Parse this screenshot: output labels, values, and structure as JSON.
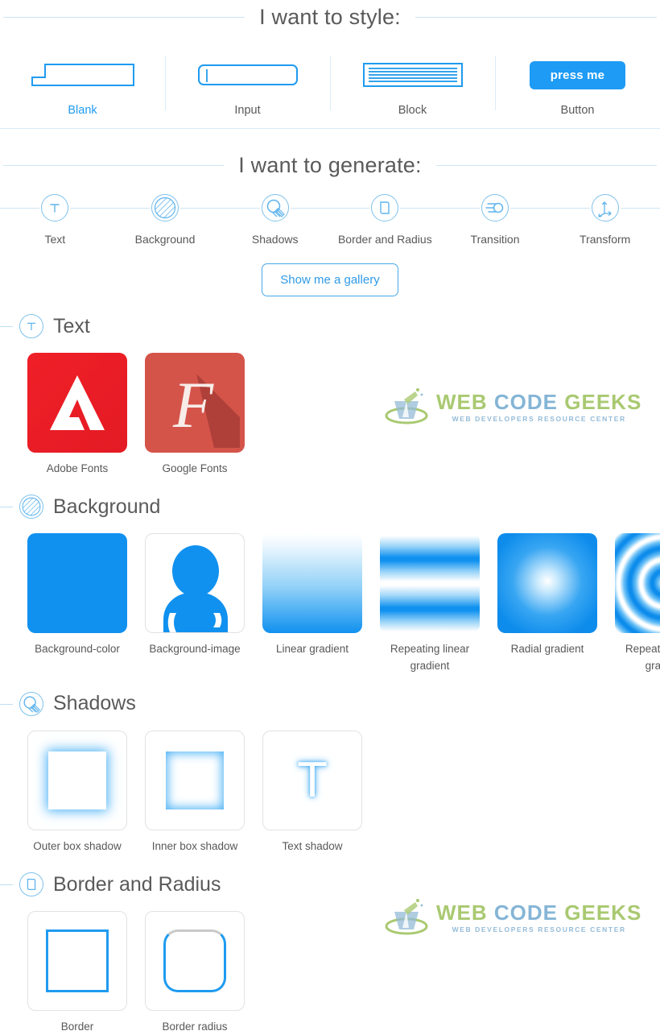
{
  "style_section": {
    "title": "I want to style:",
    "items": [
      {
        "label": "Blank",
        "icon": "blank-document-icon",
        "active": true
      },
      {
        "label": "Input",
        "icon": "text-input-icon",
        "active": false
      },
      {
        "label": "Block",
        "icon": "text-block-icon",
        "active": false
      },
      {
        "label": "Button",
        "icon": "button-icon",
        "button_label": "press me",
        "active": false
      }
    ]
  },
  "generate_section": {
    "title": "I want to generate:",
    "items": [
      {
        "label": "Text",
        "icon": "letter-t-icon"
      },
      {
        "label": "Background",
        "icon": "hatched-circle-icon"
      },
      {
        "label": "Shadows",
        "icon": "shadow-drop-icon"
      },
      {
        "label": "Border and Radius",
        "icon": "rounded-square-icon"
      },
      {
        "label": "Transition",
        "icon": "motion-lines-icon"
      },
      {
        "label": "Transform",
        "icon": "axes-arrows-icon"
      }
    ],
    "gallery_button": "Show me a gallery"
  },
  "groups": [
    {
      "title": "Text",
      "icon": "letter-t-icon",
      "cards": [
        {
          "label": "Adobe Fonts",
          "icon": "adobe-logo-icon",
          "glyph": "A"
        },
        {
          "label": "Google Fonts",
          "icon": "google-fonts-logo-icon",
          "glyph": "F"
        }
      ]
    },
    {
      "title": "Background",
      "icon": "hatched-circle-icon",
      "cards": [
        {
          "label": "Background-color",
          "icon": "solid-color-swatch-icon"
        },
        {
          "label": "Background-image",
          "icon": "person-silhouette-icon"
        },
        {
          "label": "Linear gradient",
          "icon": "linear-gradient-swatch-icon"
        },
        {
          "label": "Repeating linear gradient",
          "icon": "repeating-linear-gradient-swatch-icon"
        },
        {
          "label": "Radial gradient",
          "icon": "radial-gradient-swatch-icon"
        },
        {
          "label": "Repeating radial gradient",
          "icon": "repeating-radial-gradient-swatch-icon"
        }
      ]
    },
    {
      "title": "Shadows",
      "icon": "shadow-drop-icon",
      "cards": [
        {
          "label": "Outer box shadow",
          "icon": "outer-box-shadow-icon"
        },
        {
          "label": "Inner box shadow",
          "icon": "inner-box-shadow-icon"
        },
        {
          "label": "Text shadow",
          "icon": "text-shadow-icon",
          "glyph": "T"
        }
      ]
    },
    {
      "title": "Border and Radius",
      "icon": "rounded-square-icon",
      "cards": [
        {
          "label": "Border",
          "icon": "square-border-icon"
        },
        {
          "label": "Border radius",
          "icon": "rounded-border-icon"
        }
      ]
    }
  ],
  "watermark": {
    "word1": "WEB",
    "word2": "CODE",
    "word3": "GEEKS",
    "tagline": "WEB DEVELOPERS RESOURCE CENTER"
  },
  "colors": {
    "accent_blue": "#1f9bf0",
    "button_blue": "#1e9bf5",
    "rule_blue": "#cfe6f5",
    "text_gray": "#585858",
    "adobe_red": "#e31b24",
    "google_red": "#d5544a"
  }
}
